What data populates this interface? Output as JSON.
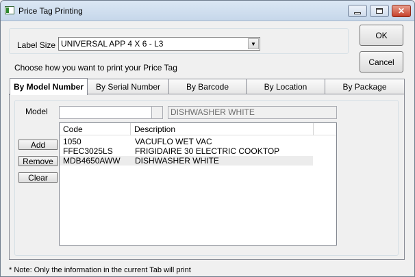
{
  "window": {
    "title": "Price Tag Printing"
  },
  "label_size": {
    "label": "Label Size",
    "value": "UNIVERSAL APP 4 X 6 - L3"
  },
  "instruction": "Choose how you want to print your Price Tag",
  "buttons": {
    "ok": "OK",
    "cancel": "Cancel",
    "add": "Add",
    "remove": "Remove",
    "clear": "Clear"
  },
  "tabs": [
    {
      "label": "By Model Number",
      "active": true
    },
    {
      "label": "By Serial Number",
      "active": false
    },
    {
      "label": "By Barcode",
      "active": false
    },
    {
      "label": "By Location",
      "active": false
    },
    {
      "label": "By Package",
      "active": false
    }
  ],
  "model": {
    "label": "Model",
    "input_value": "",
    "description": "DISHWASHER WHITE"
  },
  "list": {
    "columns": [
      "Code",
      "Description"
    ],
    "rows": [
      {
        "code": "1050",
        "description": "VACUFLO WET VAC"
      },
      {
        "code": "FFEC3025LS",
        "description": "FRIGIDAIRE 30 ELECTRIC COOKTOP"
      },
      {
        "code": "MDB4650AWW",
        "description": "DISHWASHER WHITE",
        "selected": true
      }
    ]
  },
  "footer_note": "* Note: Only the information in the current Tab will print"
}
